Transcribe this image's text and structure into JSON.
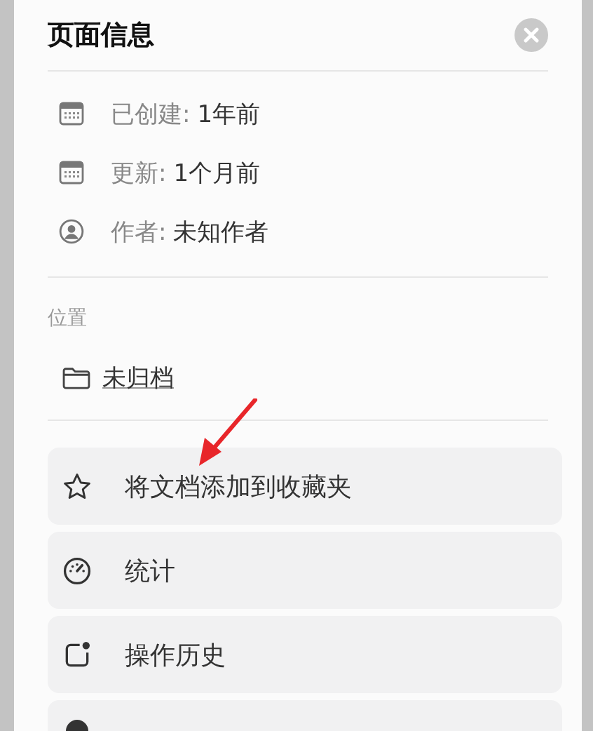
{
  "panel": {
    "title": "页面信息"
  },
  "info": [
    {
      "kind": "calendar",
      "label": "已创建:",
      "value": "1年前"
    },
    {
      "kind": "calendar",
      "label": "更新:",
      "value": "1个月前"
    },
    {
      "kind": "person",
      "label": "作者:",
      "value": "未知作者"
    }
  ],
  "location": {
    "heading": "位置",
    "folder": "未归档"
  },
  "actions": [
    {
      "kind": "star",
      "label": "将文档添加到收藏夹"
    },
    {
      "kind": "gauge",
      "label": "统计"
    },
    {
      "kind": "history",
      "label": "操作历史"
    },
    {
      "kind": "circle"
    }
  ]
}
